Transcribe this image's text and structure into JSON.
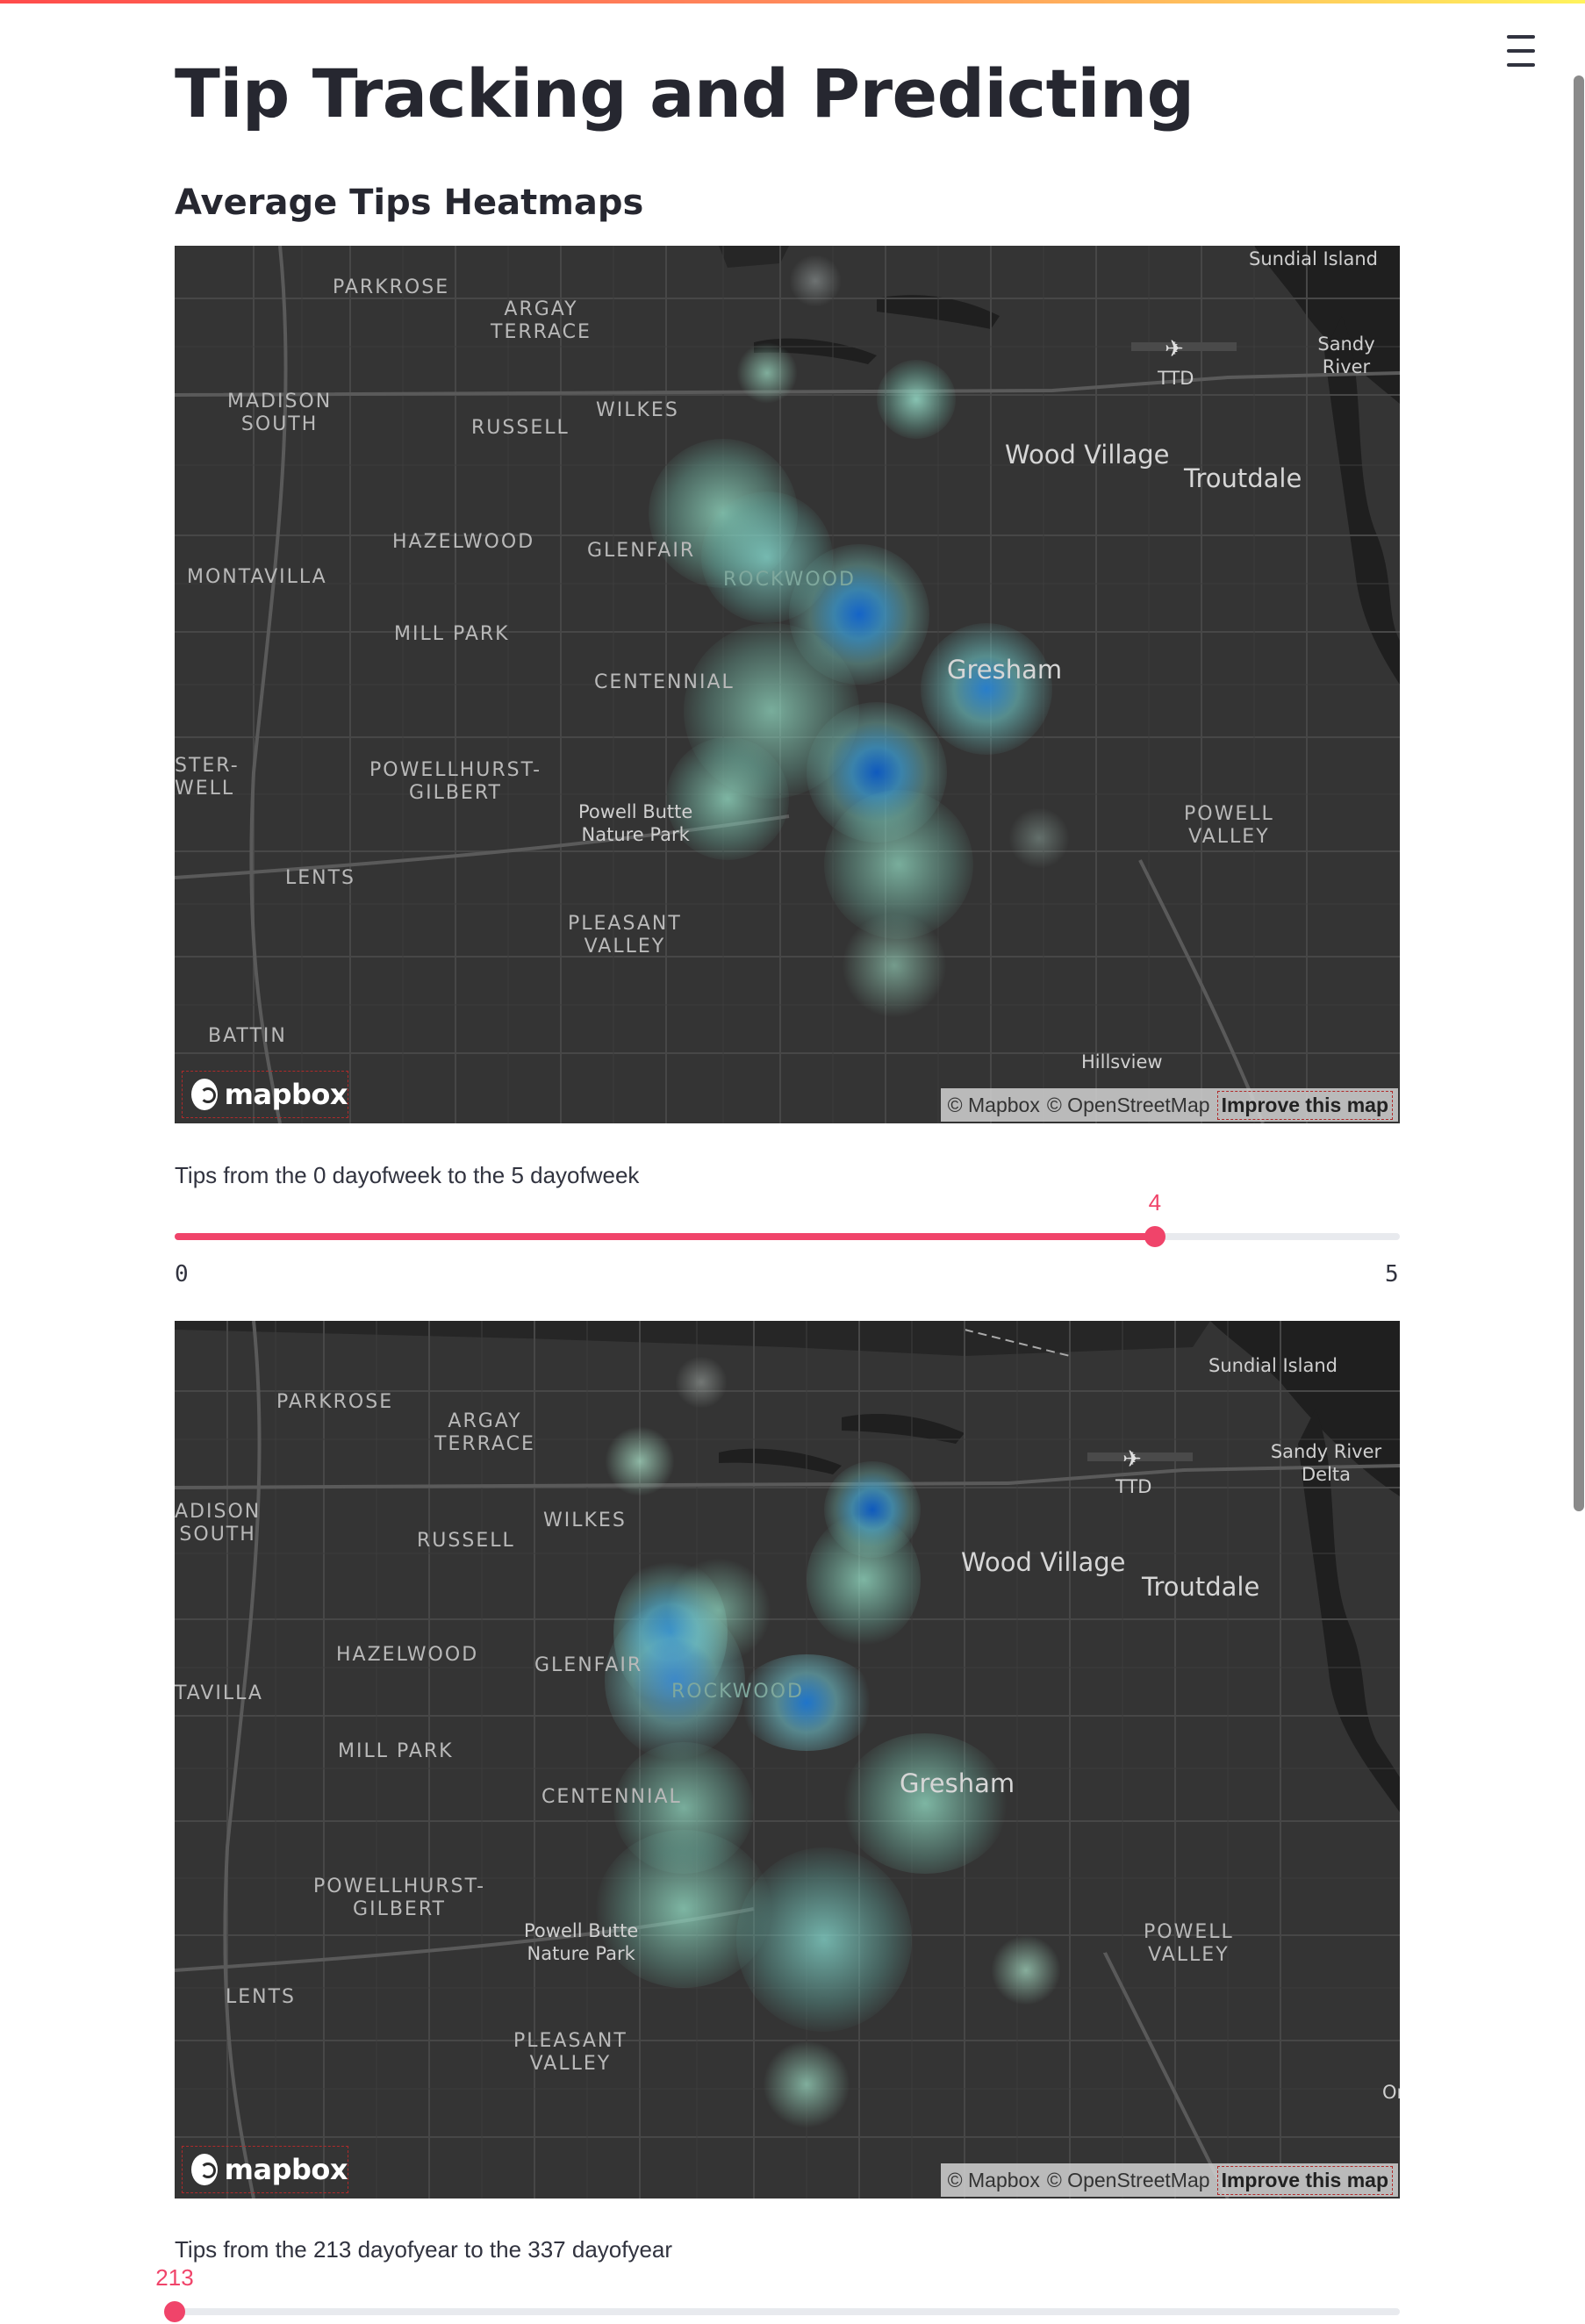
{
  "app": {
    "title": "Tip Tracking and Predicting",
    "section_title": "Average Tips Heatmaps",
    "accent_color": "#f0446a"
  },
  "map1": {
    "labels": {
      "parkrose": "PARKROSE",
      "argay_terrace": "ARGAY\nTERRACE",
      "madison_south": "MADISON\nSOUTH",
      "wilkes": "WILKES",
      "russell": "RUSSELL",
      "hazelwood": "HAZELWOOD",
      "glenfair": "GLENFAIR",
      "rockwood": "ROCKWOOD",
      "montavilla": "MONTAVILLA",
      "mill_park": "MILL PARK",
      "centennial": "CENTENNIAL",
      "foster_powell": "STER-\nWELL",
      "powellhurst_gilbert": "POWELLHURST-\nGILBERT",
      "powell_butte": "Powell Butte\nNature Park",
      "lents": "LENTS",
      "pleasant_valley": "PLEASANT\nVALLEY",
      "battin": "BATTIN",
      "hillsview": "Hillsview",
      "powell_valley": "POWELL\nVALLEY",
      "gresham": "Gresham",
      "wood_village": "Wood Village",
      "troutdale": "Troutdale",
      "ttd": "TTD",
      "sandy_river": "Sandy River",
      "sundial_island": "Sundial Island"
    },
    "logo": "mapbox",
    "attribution": {
      "mapbox": "© Mapbox",
      "osm": "© OpenStreetMap",
      "improve": "Improve this map"
    }
  },
  "slider1": {
    "label": "Tips from the 0 dayofweek to the 5 dayofweek",
    "min": 0,
    "max": 5,
    "value": 4,
    "min_label": "0",
    "max_label": "5",
    "value_label": "4"
  },
  "map2": {
    "labels": {
      "parkrose": "PARKROSE",
      "argay_terrace": "ARGAY\nTERRACE",
      "madison_south": "ADISON\nSOUTH",
      "wilkes": "WILKES",
      "russell": "RUSSELL",
      "hazelwood": "HAZELWOOD",
      "glenfair": "GLENFAIR",
      "rockwood": "ROCKWOOD",
      "montavilla": "TAVILLA",
      "mill_park": "MILL PARK",
      "centennial": "CENTENNIAL",
      "powellhurst_gilbert": "POWELLHURST-\nGILBERT",
      "powell_butte": "Powell Butte\nNature Park",
      "lents": "LENTS",
      "pleasant_valley": "PLEASANT\nVALLEY",
      "powell_valley": "POWELL\nVALLEY",
      "gresham": "Gresham",
      "wood_village": "Wood Village",
      "troutdale": "Troutdale",
      "ttd": "TTD",
      "sandy_river": "Sandy River Delta",
      "sundial_island": "Sundial Island",
      "orient": "Or"
    },
    "logo": "mapbox",
    "attribution": {
      "mapbox": "© Mapbox",
      "osm": "© OpenStreetMap",
      "improve": "Improve this map"
    }
  },
  "slider2": {
    "label": "Tips from the 213 dayofyear to the 337 dayofyear",
    "min": 213,
    "max": 337,
    "value": 213,
    "value_label": "213"
  }
}
